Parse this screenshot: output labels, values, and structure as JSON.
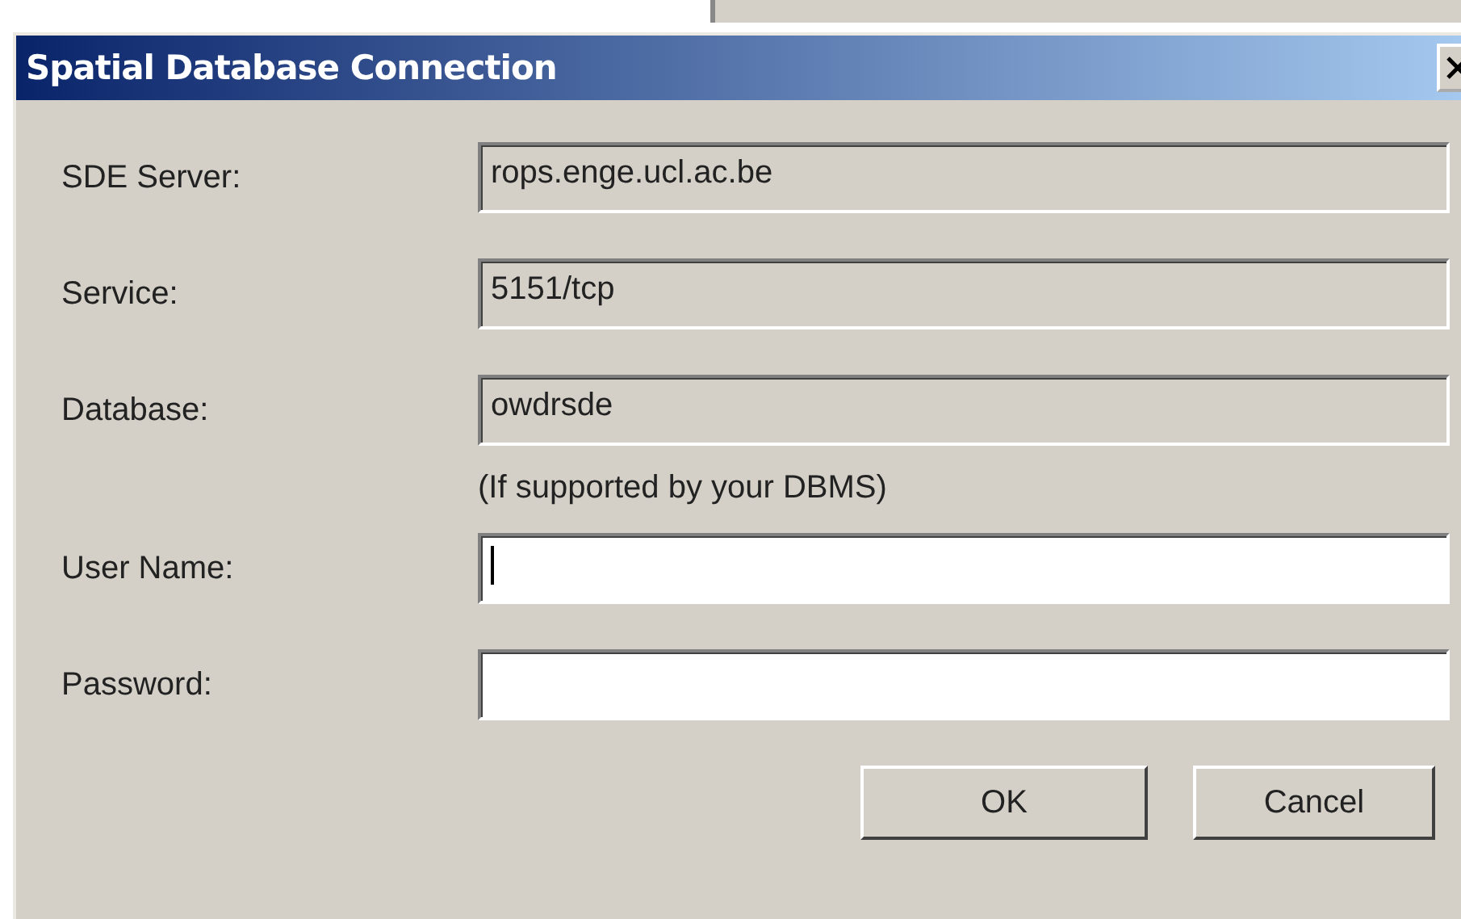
{
  "window": {
    "title": "Spatial Database Connection"
  },
  "fields": [
    {
      "label": "SDE Server:",
      "value": "rops.enge.ucl.ac.be",
      "disabled": true
    },
    {
      "label": "Service:",
      "value": "5151/tcp",
      "disabled": true
    },
    {
      "label": "Database:",
      "value": "owdrsde",
      "disabled": true
    },
    {
      "label": "User Name:",
      "disabled": false,
      "focused": true
    },
    {
      "label": "Password:",
      "disabled": false,
      "focused": false
    }
  ],
  "note": "(If supported by your DBMS)",
  "buttons": [
    "OK",
    "Cancel"
  ]
}
